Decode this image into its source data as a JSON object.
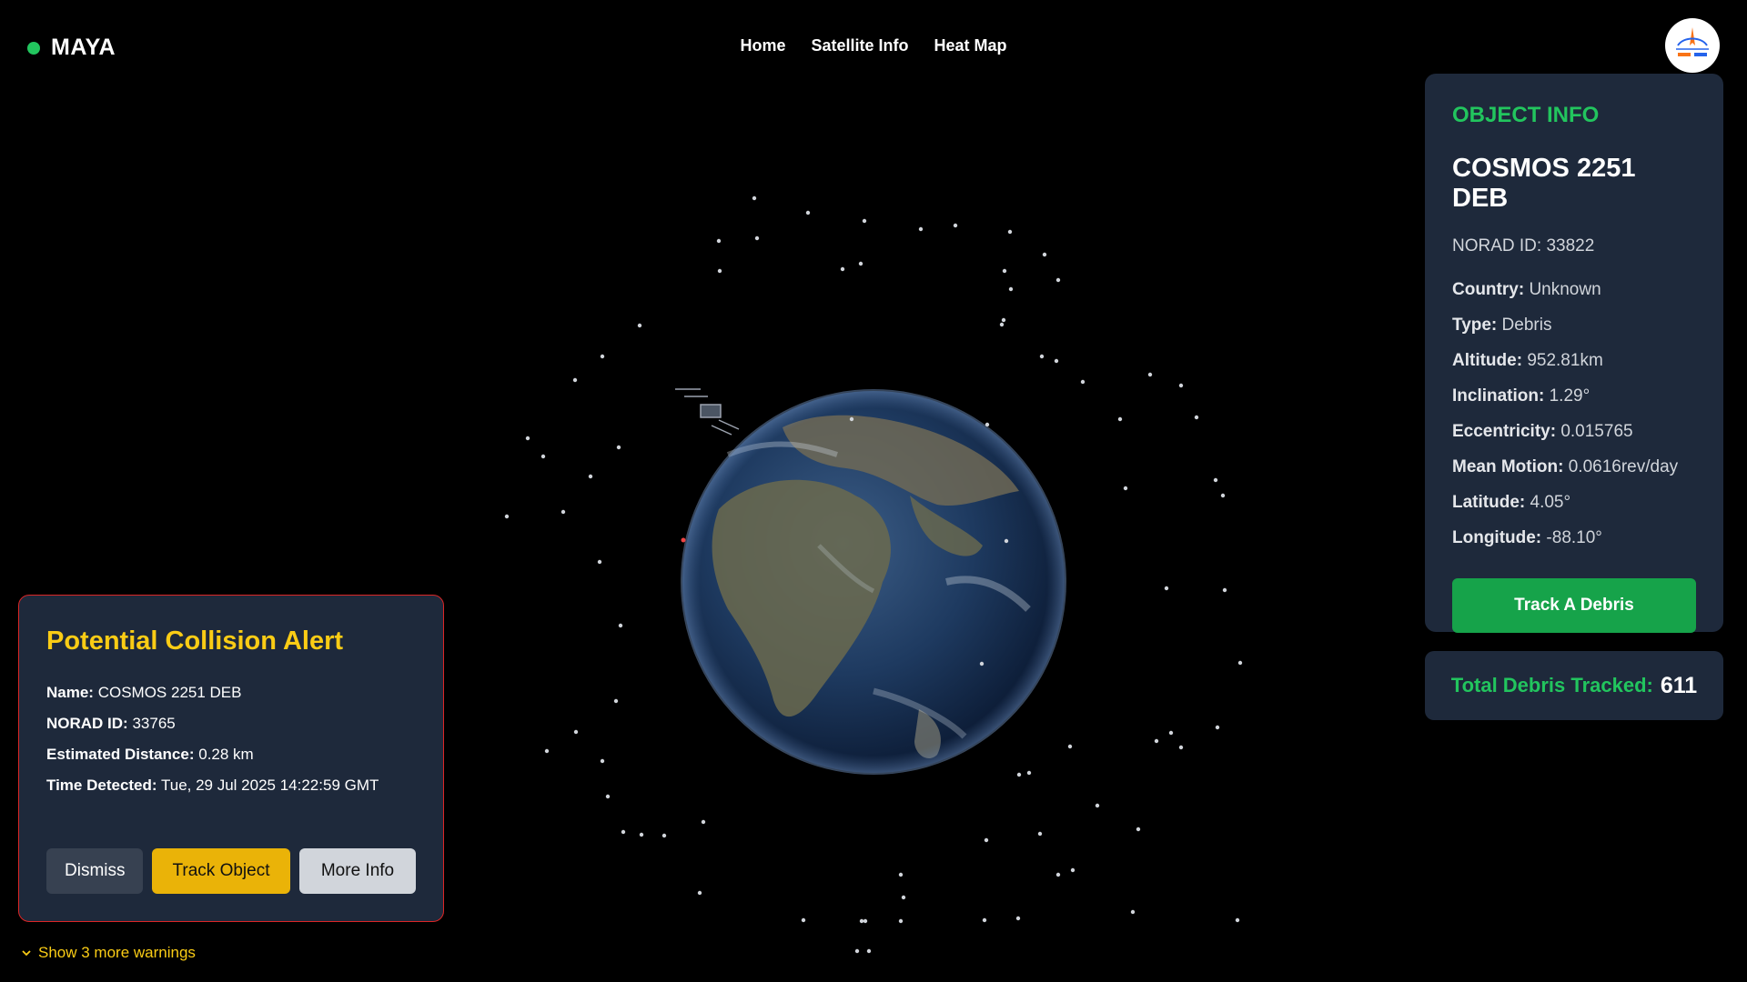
{
  "brand": {
    "name": "MAYA",
    "dot_color": "#22c55e"
  },
  "nav": {
    "items": [
      "Home",
      "Satellite Info",
      "Heat Map"
    ]
  },
  "logo": {
    "icon": "isro-logo-icon"
  },
  "object_info": {
    "heading": "OBJECT INFO",
    "name": "COSMOS 2251 DEB",
    "norad": "NORAD ID: 33822",
    "fields": [
      {
        "label": "Country:",
        "value": "Unknown"
      },
      {
        "label": "Type:",
        "value": "Debris"
      },
      {
        "label": "Altitude:",
        "value": "952.81km"
      },
      {
        "label": "Inclination:",
        "value": "1.29°"
      },
      {
        "label": "Eccentricity:",
        "value": "0.015765"
      },
      {
        "label": "Mean Motion:",
        "value": "0.0616rev/day"
      },
      {
        "label": "Latitude:",
        "value": "4.05°"
      },
      {
        "label": "Longitude:",
        "value": "-88.10°"
      }
    ],
    "button": "Track A Debris"
  },
  "total": {
    "label": "Total Debris Tracked:",
    "value": "611"
  },
  "alert": {
    "title": "Potential Collision Alert",
    "fields": [
      {
        "label": "Name:",
        "value": "COSMOS 2251 DEB"
      },
      {
        "label": "NORAD ID:",
        "value": "33765"
      },
      {
        "label": "Estimated Distance:",
        "value": "0.28 km"
      },
      {
        "label": "Time Detected:",
        "value": "Tue, 29 Jul 2025 14:22:59 GMT"
      }
    ],
    "buttons": {
      "dismiss": "Dismiss",
      "track": "Track Object",
      "more": "More Info"
    },
    "show_more": "Show 3 more warnings"
  },
  "colors": {
    "accent_green": "#22c55e",
    "alert_yellow": "#facc15",
    "alert_border": "#dc2626",
    "panel_bg": "#1e293b"
  }
}
